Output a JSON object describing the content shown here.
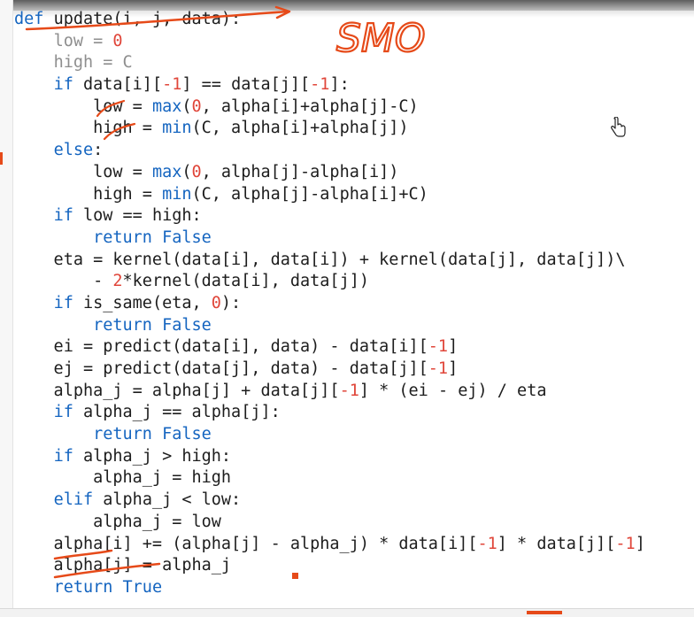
{
  "editor": {
    "accent_colors": {
      "keyword": "#1565c0",
      "number": "#e0463a",
      "ink": "#e64a19"
    },
    "lines": [
      [
        {
          "t": "def ",
          "c": "kw"
        },
        {
          "t": "update(i, j, data):",
          "c": "fn"
        }
      ],
      [
        {
          "t": "    "
        },
        {
          "t": "low = ",
          "c": "dim"
        },
        {
          "t": "0",
          "c": "num"
        }
      ],
      [
        {
          "t": "    "
        },
        {
          "t": "high = C",
          "c": "dim"
        }
      ],
      [
        {
          "t": "    "
        },
        {
          "t": "if ",
          "c": "kw"
        },
        {
          "t": "data[i]["
        },
        {
          "t": "-1",
          "c": "num"
        },
        {
          "t": "] == data[j]["
        },
        {
          "t": "-1",
          "c": "num"
        },
        {
          "t": "]:"
        }
      ],
      [
        {
          "t": "        low = "
        },
        {
          "t": "max",
          "c": "kw"
        },
        {
          "t": "("
        },
        {
          "t": "0",
          "c": "num"
        },
        {
          "t": ", alpha[i]+alpha[j]-C)"
        }
      ],
      [
        {
          "t": "        high = "
        },
        {
          "t": "min",
          "c": "kw"
        },
        {
          "t": "(C, alpha[i]+alpha[j])"
        }
      ],
      [
        {
          "t": "    "
        },
        {
          "t": "else",
          "c": "kw"
        },
        {
          "t": ":"
        }
      ],
      [
        {
          "t": "        low = "
        },
        {
          "t": "max",
          "c": "kw"
        },
        {
          "t": "("
        },
        {
          "t": "0",
          "c": "num"
        },
        {
          "t": ", alpha[j]-alpha[i])"
        }
      ],
      [
        {
          "t": "        high = "
        },
        {
          "t": "min",
          "c": "kw"
        },
        {
          "t": "(C, alpha[j]-alpha[i]+C)"
        }
      ],
      [
        {
          "t": "    "
        },
        {
          "t": "if ",
          "c": "kw"
        },
        {
          "t": "low == high:"
        }
      ],
      [
        {
          "t": "        "
        },
        {
          "t": "return False",
          "c": "kw"
        }
      ],
      [
        {
          "t": "    eta = kernel(data[i], data[i]) + kernel(data[j], data[j])\\"
        }
      ],
      [
        {
          "t": "        - "
        },
        {
          "t": "2",
          "c": "num"
        },
        {
          "t": "*kernel(data[i], data[j])"
        }
      ],
      [
        {
          "t": "    "
        },
        {
          "t": "if ",
          "c": "kw"
        },
        {
          "t": "is_same(eta, "
        },
        {
          "t": "0",
          "c": "num"
        },
        {
          "t": "):"
        }
      ],
      [
        {
          "t": "        "
        },
        {
          "t": "return False",
          "c": "kw"
        }
      ],
      [
        {
          "t": "    ei = predict(data[i], data) - data[i]["
        },
        {
          "t": "-1",
          "c": "num"
        },
        {
          "t": "]"
        }
      ],
      [
        {
          "t": "    ej = predict(data[j], data) - data[j]["
        },
        {
          "t": "-1",
          "c": "num"
        },
        {
          "t": "]"
        }
      ],
      [
        {
          "t": "    alpha_j = alpha[j] + data[j]["
        },
        {
          "t": "-1",
          "c": "num"
        },
        {
          "t": "] * (ei - ej) / eta"
        }
      ],
      [
        {
          "t": "    "
        },
        {
          "t": "if ",
          "c": "kw"
        },
        {
          "t": "alpha_j == alpha[j]:"
        }
      ],
      [
        {
          "t": "        "
        },
        {
          "t": "return False",
          "c": "kw"
        }
      ],
      [
        {
          "t": "    "
        },
        {
          "t": "if ",
          "c": "kw"
        },
        {
          "t": "alpha_j > high:"
        }
      ],
      [
        {
          "t": "        alpha_j = high"
        }
      ],
      [
        {
          "t": "    "
        },
        {
          "t": "elif ",
          "c": "kw"
        },
        {
          "t": "alpha_j < low:"
        }
      ],
      [
        {
          "t": "        alpha_j = low"
        }
      ],
      [
        {
          "t": "    alpha[i] += (alpha[j] - alpha_j) * data[i]["
        },
        {
          "t": "-1",
          "c": "num"
        },
        {
          "t": "] * data[j]["
        },
        {
          "t": "-1",
          "c": "num"
        },
        {
          "t": "]"
        }
      ],
      [
        {
          "t": "    alpha[j] = alpha_j"
        }
      ],
      [
        {
          "t": "    "
        },
        {
          "t": "return True",
          "c": "kw"
        }
      ]
    ]
  },
  "handwriting": {
    "text": "SMO"
  }
}
